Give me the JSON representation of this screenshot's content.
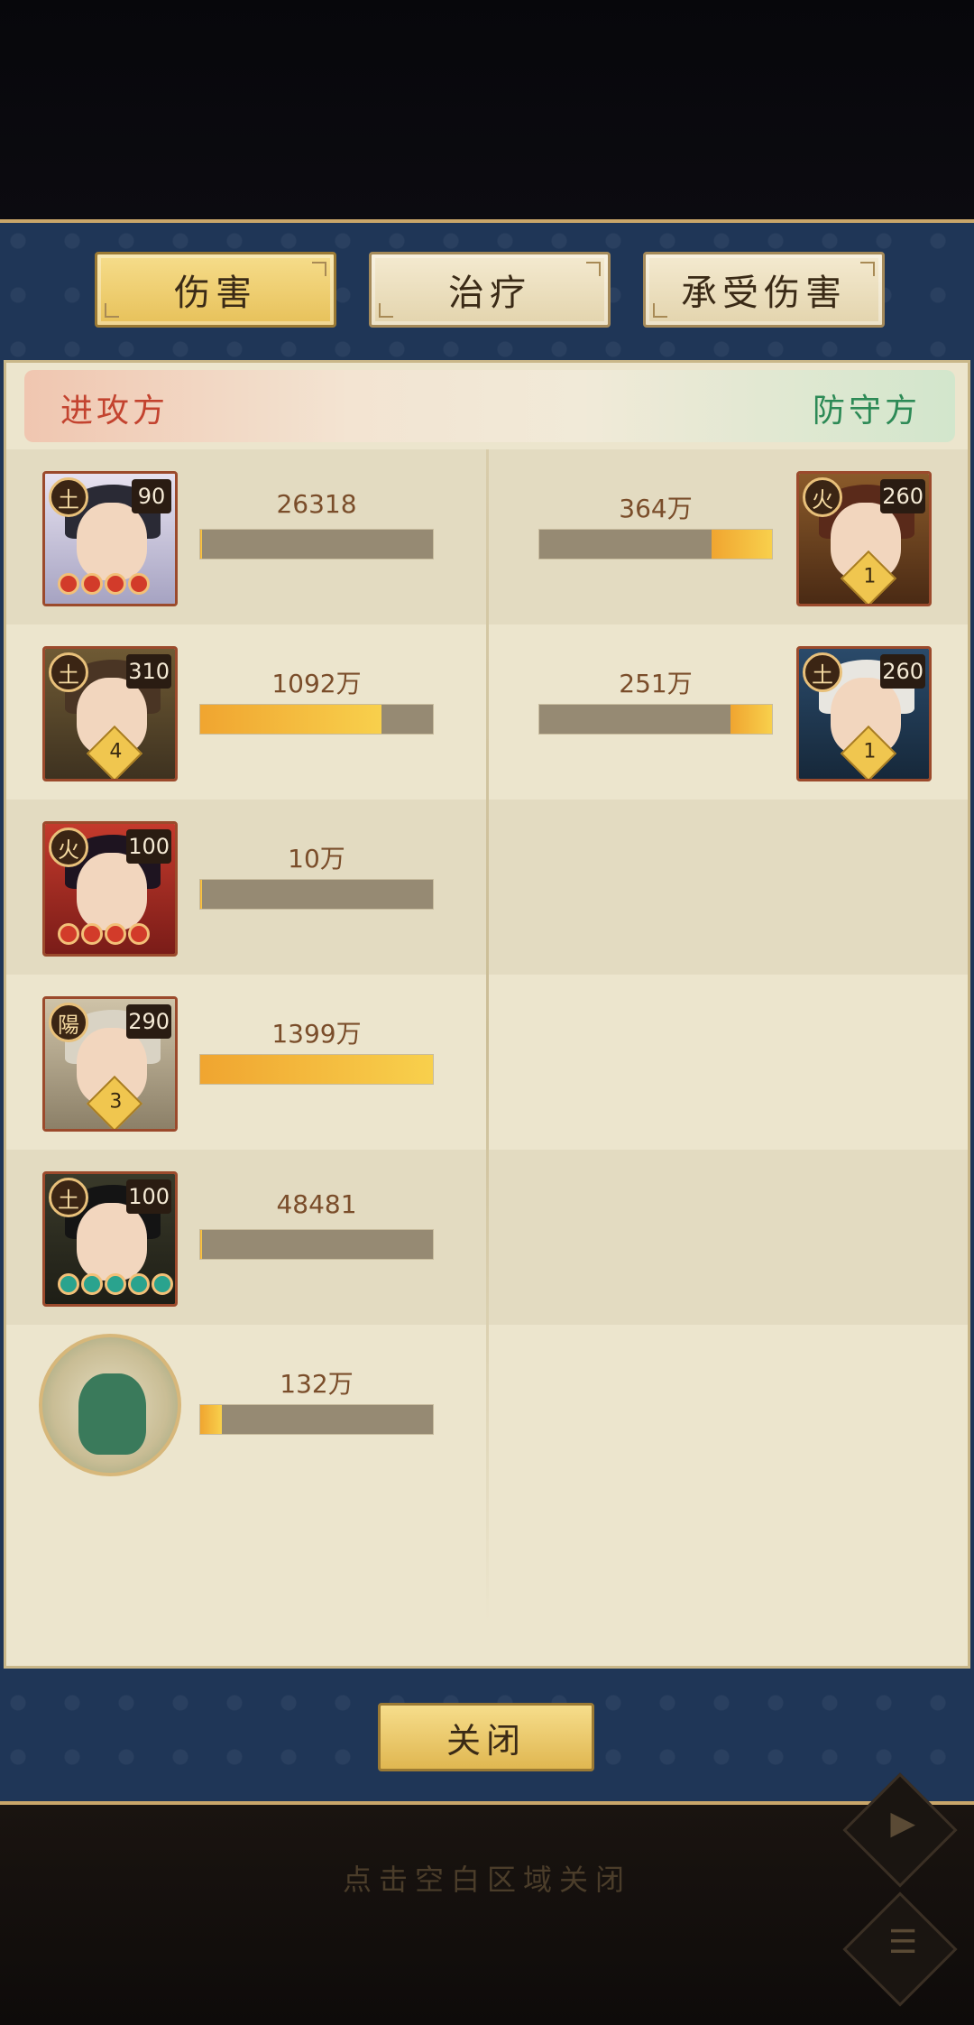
{
  "tabs": [
    {
      "label": "伤害",
      "active": true
    },
    {
      "label": "治疗",
      "active": false
    },
    {
      "label": "承受伤害",
      "active": false
    }
  ],
  "header": {
    "attacker": "进攻方",
    "defender": "防守方"
  },
  "attackers": [
    {
      "element": "土",
      "level": "90",
      "value": "26318",
      "fill": 0.002,
      "stars": "red",
      "rank": ""
    },
    {
      "element": "土",
      "level": "310",
      "value": "1092万",
      "fill": 0.78,
      "stars": "",
      "rank": "4"
    },
    {
      "element": "火",
      "level": "100",
      "value": "10万",
      "fill": 0.007,
      "stars": "red",
      "rank": ""
    },
    {
      "element": "陽",
      "level": "290",
      "value": "1399万",
      "fill": 1.0,
      "stars": "",
      "rank": "3"
    },
    {
      "element": "土",
      "level": "100",
      "value": "48481",
      "fill": 0.003,
      "stars": "green",
      "rank": ""
    },
    {
      "element": "",
      "level": "",
      "value": "132万",
      "fill": 0.094,
      "stars": "",
      "rank": ""
    }
  ],
  "defenders": [
    {
      "element": "火",
      "level": "260",
      "value": "364万",
      "fill": 0.26,
      "rank": "1"
    },
    {
      "element": "土",
      "level": "260",
      "value": "251万",
      "fill": 0.18,
      "rank": "1"
    }
  ],
  "close_button": "关闭",
  "hint": "点击空白区域关闭",
  "colors": {
    "accent": "#e7c15a",
    "panel": "#1f3657",
    "attacker": "#c3432f",
    "defender": "#2d8a56"
  }
}
